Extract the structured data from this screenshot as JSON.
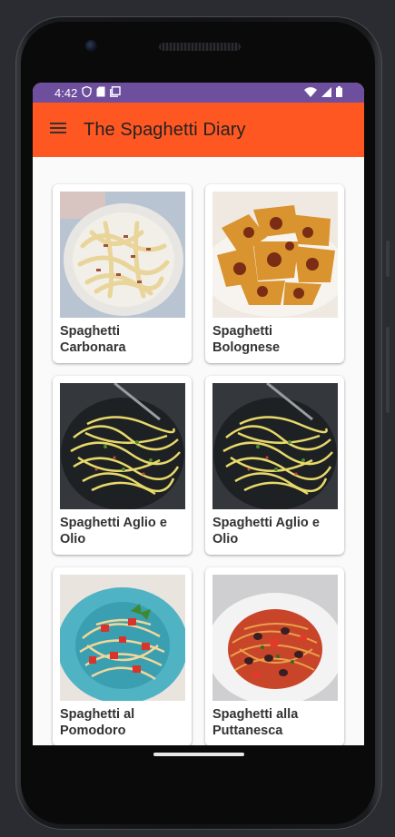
{
  "status_bar": {
    "time": "4:42"
  },
  "app_bar": {
    "title": "The Spaghetti Diary"
  },
  "recipes": [
    {
      "name": "Spaghetti Carbonara"
    },
    {
      "name": "Spaghetti Bolognese"
    },
    {
      "name": "Spaghetti Aglio e Olio"
    },
    {
      "name": "Spaghetti Aglio e Olio"
    },
    {
      "name": "Spaghetti al Pomodoro"
    },
    {
      "name": "Spaghetti alla Puttanesca"
    }
  ],
  "colors": {
    "status_bar": "#6d4f9e",
    "app_bar": "#ff5722",
    "background": "#fafafa",
    "card": "#ffffff"
  },
  "icons": [
    "menu-icon",
    "shield-icon",
    "sd-card-icon",
    "screenshot-icon",
    "wifi-icon",
    "signal-icon",
    "battery-icon"
  ]
}
